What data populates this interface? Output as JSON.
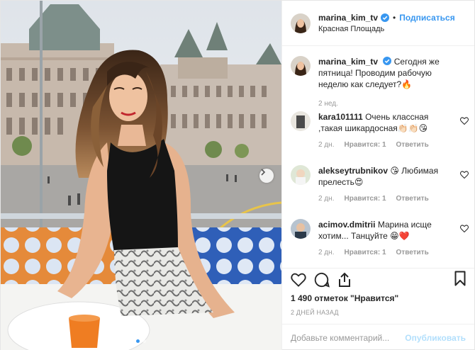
{
  "photo": {
    "alt_subject": "Woman in black top at table with view of Red Square",
    "slide_count": 2,
    "active_slide": 1
  },
  "post": {
    "author": {
      "username": "marina_kim_tv",
      "verified": true,
      "icon": "verified-badge-icon"
    },
    "follow_label": "Подписаться",
    "separator": "•",
    "location": "Красная Площадь",
    "caption": {
      "username": "marina_kim_tv",
      "text": "Сегодня же пятница! Проводим рабочую неделю как следует?🔥",
      "age": "2 нед."
    },
    "comments": [
      {
        "username": "kara101111",
        "text": "Очень классная ,такая шикардосная👏🏻👏🏻😘",
        "age": "2 дн.",
        "likes": "Нравится: 1",
        "reply": "Ответить"
      },
      {
        "username": "alekseytrubnikov",
        "text": "😘 Любимая прелесть😍",
        "age": "2 дн.",
        "likes": "Нравится: 1",
        "reply": "Ответить"
      },
      {
        "username": "acimov.dmitrii",
        "text": "Марина исще хотим... Танцуйте 😁❤️",
        "age": "2 дн.",
        "likes": "Нравится: 1",
        "reply": "Ответить"
      }
    ],
    "likes_text": "1 490 отметок \"Нравится\"",
    "date_text": "2 ДНЕЙ НАЗАД",
    "comment_input": {
      "placeholder": "Добавьте комментарий...",
      "value": ""
    },
    "publish_label": "Опубликовать"
  },
  "colors": {
    "accent": "#3897f0",
    "muted": "#999999",
    "publish_disabled": "#b2dffc",
    "heart": "#ed4956"
  }
}
